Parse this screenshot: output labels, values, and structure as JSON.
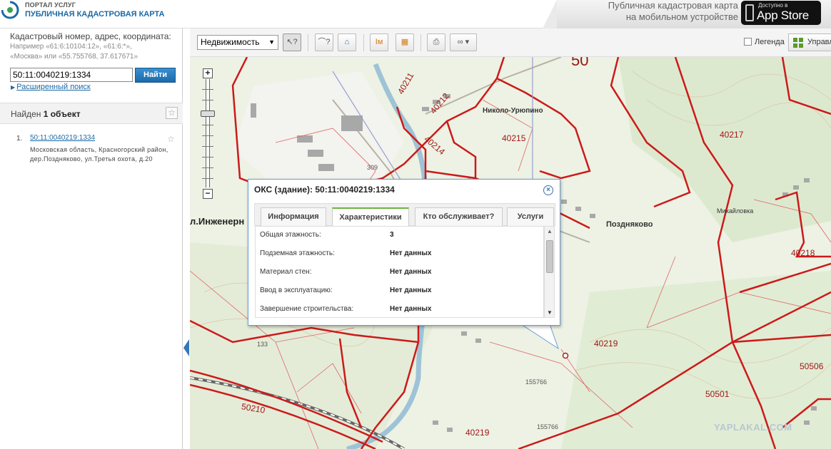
{
  "header": {
    "portal_small": "ПОРТАЛ УСЛУГ",
    "portal_title": "ПУБЛИЧНАЯ КАДАСТРОВАЯ КАРТА",
    "mobile_line1": "Публичная кадастровая карта",
    "mobile_line2": "на мобильном устройстве",
    "appstore_small": "Доступно в",
    "appstore_big": "App Store",
    "logo_color": "#1b6aa5"
  },
  "sidebar": {
    "search_label": "Кадастровый номер, адрес, координата:",
    "hint_line1": "Например «61:6:10104:12», «61:6:*»,",
    "hint_line2": "«Москва» или «55.755768, 37.617671»",
    "search_value": "50:11:0040219:1334",
    "search_button": "Найти",
    "advanced_search": "Расширенный поиск",
    "found_prefix": "Найден ",
    "found_count": "1 объект",
    "results": [
      {
        "number": "1.",
        "link": "50:11:0040219:1334",
        "address": "Московская область, Красногорский район, дер.Поздняково, ул.Третья охота, д.20"
      }
    ]
  },
  "toolbar": {
    "layer_select": "Недвижимость",
    "legend_label": "Легенда",
    "manage_label": "Управл"
  },
  "map": {
    "labels": {
      "big_50": "50",
      "inzh": "л.Инженерн",
      "nikolo": "Николо-Урюпино",
      "pozdnyakovo": "Поздняково",
      "mikhailovka": "Михайловка",
      "q40211": "40211",
      "q40212": "40212",
      "q40214": "40214",
      "q40215": "40215",
      "q40217": "40217",
      "q40218": "40218",
      "q40219a": "40219",
      "q40219b": "40219",
      "q50210": "50210",
      "q50501": "50501",
      "q50506": "50506",
      "n309": "309",
      "n133": "133",
      "n155766a": "155766",
      "n155766b": "155766"
    },
    "watermark": "YAPLAKAL.COM",
    "boundary_color": "#cc1a1a"
  },
  "popup": {
    "title": "ОКС (здание): 50:11:0040219:1334",
    "tabs": [
      "Информация",
      "Характеристики",
      "Кто обслуживает?",
      "Услуги"
    ],
    "active_tab": "Характеристики",
    "rows": [
      {
        "label": "Общая этажность:",
        "value": "3"
      },
      {
        "label": "Подземная этажность:",
        "value": "Нет данных"
      },
      {
        "label": "Материал стен:",
        "value": "Нет данных"
      },
      {
        "label": "Ввод в эксплуатацию:",
        "value": "Нет данных"
      },
      {
        "label": "Завершение строительства:",
        "value": "Нет данных"
      }
    ]
  }
}
